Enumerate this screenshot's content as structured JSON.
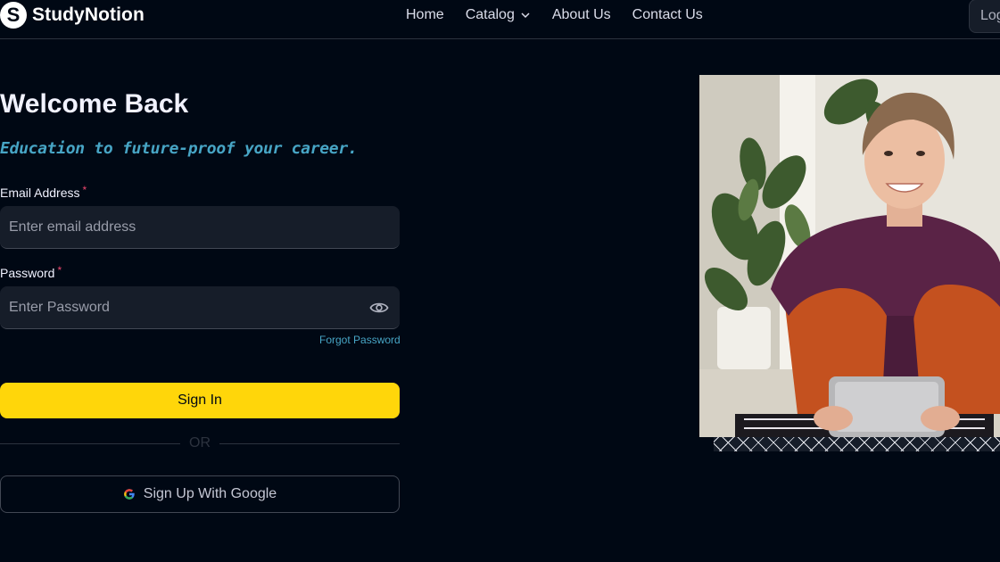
{
  "brand": {
    "logo_letter": "S",
    "name": "StudyNotion"
  },
  "nav": {
    "links": [
      {
        "label": "Home"
      },
      {
        "label": "Catalog"
      },
      {
        "label": "About Us"
      },
      {
        "label": "Contact Us"
      }
    ],
    "login_label": "Log"
  },
  "form": {
    "title": "Welcome Back",
    "subtitle": "Education to future-proof your career.",
    "email_label": "Email Address",
    "email_placeholder": "Enter email address",
    "password_label": "Password",
    "password_placeholder": "Enter Password",
    "required_mark": "*",
    "forgot_label": "Forgot Password",
    "signin_label": "Sign In",
    "or_label": "OR",
    "google_label": "Sign Up With Google"
  },
  "colors": {
    "background": "#000814",
    "accent_yellow": "#FFD60A",
    "accent_blue": "#47A5C5",
    "required_pink": "#EF476F"
  }
}
